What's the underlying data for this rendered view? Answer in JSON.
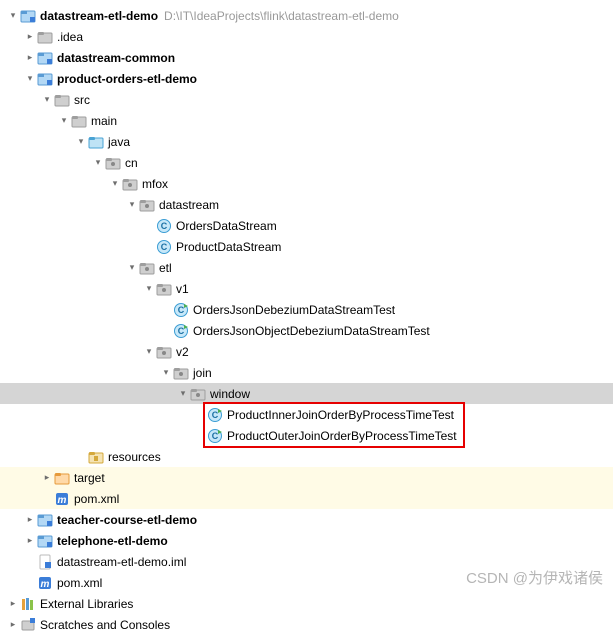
{
  "watermark": "CSDN @为伊戏诸侯",
  "tree": [
    {
      "depth": 0,
      "arrow": "down",
      "icon": "module",
      "label": "datastream-etl-demo",
      "bold": true,
      "path": "D:\\IT\\IdeaProjects\\flink\\datastream-etl-demo",
      "interactable": true
    },
    {
      "depth": 1,
      "arrow": "right",
      "icon": "folder",
      "label": ".idea",
      "interactable": true
    },
    {
      "depth": 1,
      "arrow": "right",
      "icon": "module",
      "label": "datastream-common",
      "bold": true,
      "interactable": true
    },
    {
      "depth": 1,
      "arrow": "down",
      "icon": "module",
      "label": "product-orders-etl-demo",
      "bold": true,
      "interactable": true
    },
    {
      "depth": 2,
      "arrow": "down",
      "icon": "folder",
      "label": "src",
      "interactable": true
    },
    {
      "depth": 3,
      "arrow": "down",
      "icon": "folder",
      "label": "main",
      "interactable": true
    },
    {
      "depth": 4,
      "arrow": "down",
      "icon": "source",
      "label": "java",
      "interactable": true
    },
    {
      "depth": 5,
      "arrow": "down",
      "icon": "package",
      "label": "cn",
      "interactable": true
    },
    {
      "depth": 6,
      "arrow": "down",
      "icon": "package",
      "label": "mfox",
      "interactable": true
    },
    {
      "depth": 7,
      "arrow": "down",
      "icon": "package",
      "label": "datastream",
      "interactable": true
    },
    {
      "depth": 8,
      "arrow": "none",
      "icon": "class-c",
      "label": "OrdersDataStream",
      "interactable": true
    },
    {
      "depth": 8,
      "arrow": "none",
      "icon": "class-c",
      "label": "ProductDataStream",
      "interactable": true
    },
    {
      "depth": 7,
      "arrow": "down",
      "icon": "package",
      "label": "etl",
      "interactable": true
    },
    {
      "depth": 8,
      "arrow": "down",
      "icon": "package",
      "label": "v1",
      "interactable": true
    },
    {
      "depth": 9,
      "arrow": "none",
      "icon": "test-c",
      "label": "OrdersJsonDebeziumDataStreamTest",
      "interactable": true
    },
    {
      "depth": 9,
      "arrow": "none",
      "icon": "test-c",
      "label": "OrdersJsonObjectDebeziumDataStreamTest",
      "interactable": true
    },
    {
      "depth": 8,
      "arrow": "down",
      "icon": "package",
      "label": "v2",
      "interactable": true
    },
    {
      "depth": 9,
      "arrow": "down",
      "icon": "package",
      "label": "join",
      "interactable": true
    },
    {
      "depth": 10,
      "arrow": "down",
      "icon": "package",
      "label": "window",
      "interactable": true,
      "selected": true
    },
    {
      "depth": 11,
      "arrow": "none",
      "icon": "test-c",
      "label": "ProductInnerJoinOrderByProcessTimeTest",
      "interactable": true,
      "boxed": true
    },
    {
      "depth": 11,
      "arrow": "none",
      "icon": "test-c",
      "label": "ProductOuterJoinOrderByProcessTimeTest",
      "interactable": true,
      "boxed": true
    },
    {
      "depth": 4,
      "arrow": "none",
      "icon": "res",
      "label": "resources",
      "interactable": true
    },
    {
      "depth": 2,
      "arrow": "right",
      "icon": "target",
      "label": "target",
      "interactable": true,
      "hl": "yellow"
    },
    {
      "depth": 2,
      "arrow": "none",
      "icon": "maven",
      "label": "pom.xml",
      "interactable": true,
      "hl": "yellow"
    },
    {
      "depth": 1,
      "arrow": "right",
      "icon": "module",
      "label": "teacher-course-etl-demo",
      "bold": true,
      "interactable": true
    },
    {
      "depth": 1,
      "arrow": "right",
      "icon": "module",
      "label": "telephone-etl-demo",
      "bold": true,
      "interactable": true
    },
    {
      "depth": 1,
      "arrow": "none",
      "icon": "iml",
      "label": "datastream-etl-demo.iml",
      "interactable": true
    },
    {
      "depth": 1,
      "arrow": "none",
      "icon": "maven",
      "label": "pom.xml",
      "interactable": true
    },
    {
      "depth": 0,
      "arrow": "right",
      "icon": "lib",
      "label": "External Libraries",
      "interactable": true
    },
    {
      "depth": 0,
      "arrow": "right",
      "icon": "scratch",
      "label": "Scratches and Consoles",
      "interactable": true
    }
  ]
}
